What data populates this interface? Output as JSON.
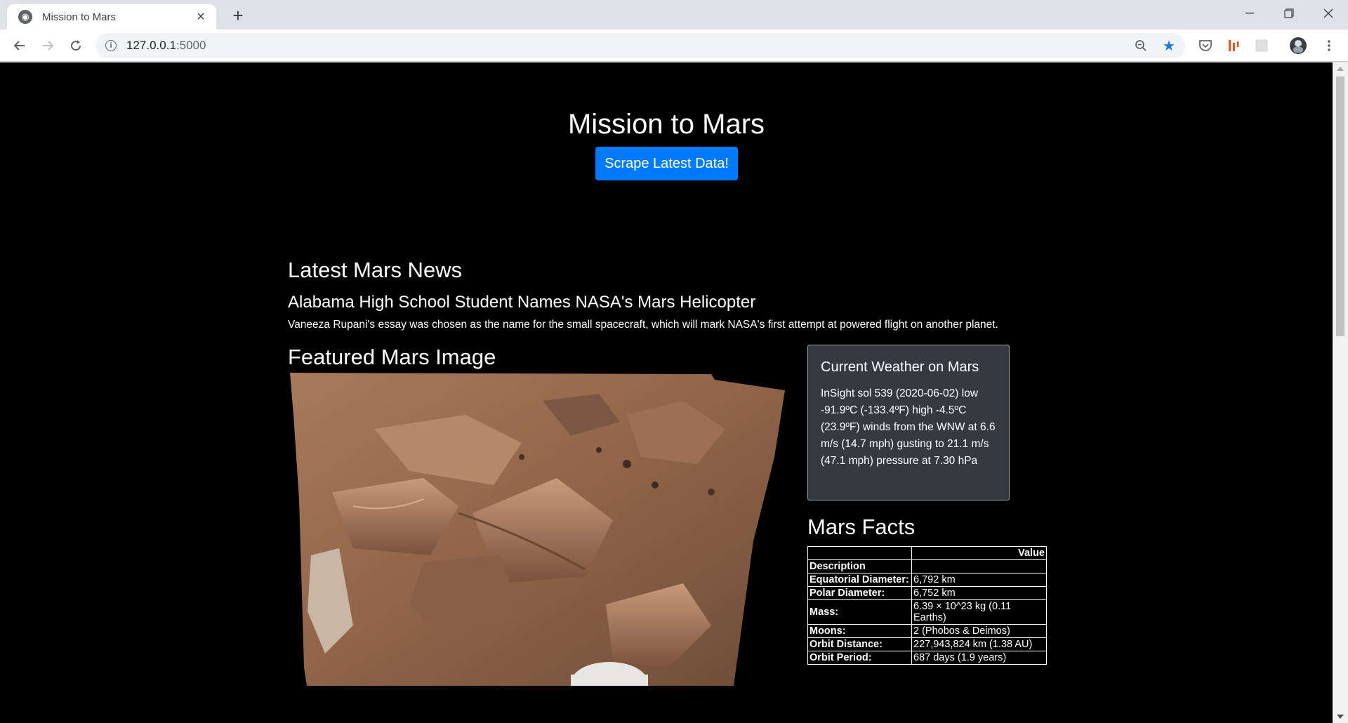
{
  "browser": {
    "tab_title": "Mission to Mars",
    "url_host": "127.0.0.1",
    "url_port": ":5000"
  },
  "page": {
    "title": "Mission to Mars",
    "scrape_button": "Scrape Latest Data!",
    "news": {
      "heading": "Latest Mars News",
      "headline": "Alabama High School Student Names NASA's Mars Helicopter",
      "teaser": "Vaneeza Rupani's essay was chosen as the name for the small spacecraft, which will mark NASA's first attempt at powered flight on another planet."
    },
    "featured": {
      "heading": "Featured Mars Image"
    },
    "weather": {
      "title": "Current Weather on Mars",
      "body": "InSight sol 539 (2020-06-02) low -91.9ºC (-133.4ºF) high -4.5ºC (23.9ºF) winds from the WNW at 6.6 m/s (14.7 mph) gusting to 21.1 m/s (47.1 mph) pressure at 7.30 hPa"
    },
    "facts": {
      "heading": "Mars Facts",
      "header_value": "Value",
      "header_desc": "Description",
      "rows": [
        {
          "label": "Equatorial Diameter:",
          "value": "6,792 km"
        },
        {
          "label": "Polar Diameter:",
          "value": "6,752 km"
        },
        {
          "label": "Mass:",
          "value": "6.39 × 10^23 kg (0.11 Earths)"
        },
        {
          "label": "Moons:",
          "value": "2 (Phobos & Deimos)"
        },
        {
          "label": "Orbit Distance:",
          "value": "227,943,824 km (1.38 AU)"
        },
        {
          "label": "Orbit Period:",
          "value": "687 days (1.9 years)"
        }
      ]
    }
  },
  "colors": {
    "page_bg": "#000000",
    "button_primary": "#007bff",
    "card_bg": "#343a40",
    "bookmark_star": "#1a73e8"
  },
  "icons": {
    "tab_favicon": "globe-icon",
    "tab_close": "close-icon",
    "new_tab": "plus-icon",
    "back": "arrow-left-icon",
    "forward": "arrow-right-icon",
    "reload": "reload-icon",
    "site_info": "info-icon",
    "zoom": "zoom-out-icon",
    "bookmark": "star-icon",
    "menu": "kebab-menu-icon"
  }
}
